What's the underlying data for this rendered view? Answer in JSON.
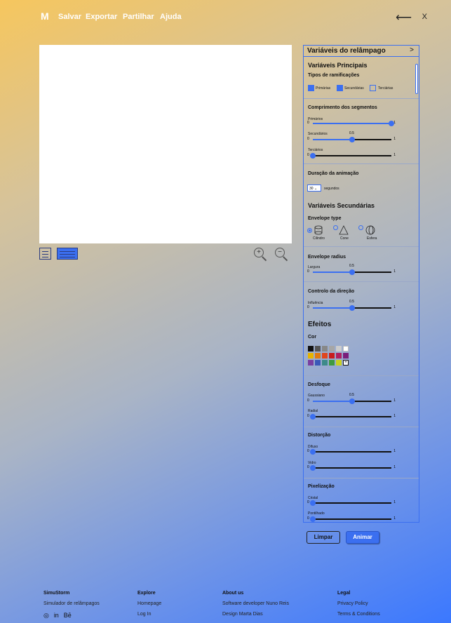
{
  "nav": {
    "logo": "M",
    "items": [
      "Salvar",
      "Exportar",
      "Partilhar",
      "Ajuda"
    ],
    "back_icon": "⟵",
    "close": "X"
  },
  "panel": {
    "title": "Variáveis do relâmpago",
    "chevron": ">",
    "main_vars": "Variáveis Principais",
    "branch_types": "Tipos de ramificações",
    "branches": [
      {
        "label": "Primárias",
        "checked": true
      },
      {
        "label": "Secundárias",
        "checked": true
      },
      {
        "label": "Terciárias",
        "checked": false
      }
    ],
    "seg_length": "Comprimento dos segmentos",
    "seg": [
      {
        "label": "Primários",
        "min": "0",
        "max": "1",
        "value": 1.0,
        "value_label": ""
      },
      {
        "label": "Secundários",
        "min": "0",
        "max": "1",
        "value": 0.5,
        "value_label": "0.5"
      },
      {
        "label": "Terciários",
        "min": "0",
        "max": "1",
        "value": 0.0,
        "value_label": ""
      }
    ],
    "anim_duration": "Duração da animação",
    "anim_value": "30",
    "anim_unit": "segundos",
    "sec_vars": "Variáveis Secundárias",
    "envelope_type": "Envelope type",
    "envelopes": [
      {
        "label": "Cilindro",
        "selected": true
      },
      {
        "label": "Cone",
        "selected": false
      },
      {
        "label": "Esfera",
        "selected": false
      }
    ],
    "envelope_radius": "Envelope radius",
    "largura": {
      "label": "Largura",
      "min": "0",
      "max": "1",
      "value": 0.5,
      "value_label": "0.5"
    },
    "dir_control": "Controlo da direção",
    "influencia": {
      "label": "Influência",
      "min": "0",
      "max": "1",
      "value": 0.5,
      "value_label": "0.5"
    },
    "effects": "Efeitos",
    "color": "Cor",
    "swatches": [
      "#111111",
      "#555555",
      "#888888",
      "#a6a6a6",
      "#cccccc",
      "#ffffff",
      "#e8b300",
      "#e07a10",
      "#e0461e",
      "#c81e1e",
      "#b02060",
      "#7a1f7a",
      "#7a3fa0",
      "#3b58b8",
      "#3d8a8a",
      "#3f9a3f",
      "#c8d020",
      "#ffffff"
    ],
    "blur": "Desfoque",
    "gaussiano": {
      "label": "Gaussiano",
      "min": "0",
      "max": "1",
      "value": 0.5,
      "value_label": "0.5"
    },
    "radial": {
      "label": "Radial",
      "min": "0",
      "max": "1",
      "value": 0.0,
      "value_label": ""
    },
    "distortion": "Distorção",
    "difuso": {
      "label": "Difuso",
      "min": "0",
      "max": "1",
      "value": 0.0,
      "value_label": ""
    },
    "vidro": {
      "label": "Vidro",
      "min": "0",
      "max": "1",
      "value": 0.0,
      "value_label": ""
    },
    "pixel": "Pixelização",
    "cristal": {
      "label": "Cristal",
      "min": "0",
      "max": "1",
      "value": 0.0,
      "value_label": ""
    },
    "pontilhado": {
      "label": "Pontilhado",
      "min": "0",
      "max": "1",
      "value": 0.0,
      "value_label": ""
    }
  },
  "buttons": {
    "clear": "Limpar",
    "animate": "Animar"
  },
  "footer": {
    "c1": {
      "title": "SimuStorm",
      "r1": "Simulador de relâmpagos",
      "social": [
        "◎",
        "in",
        "Bē"
      ]
    },
    "c2": {
      "title": "Explore",
      "r1": "Homepage",
      "r2": "Log In"
    },
    "c3": {
      "title": "About us",
      "r1": "Software developer Nuno Reis",
      "r2": "Design Marta Dias"
    },
    "c4": {
      "title": "Legal",
      "r1": "Privacy Policy",
      "r2": "Terms & Conditions"
    }
  }
}
